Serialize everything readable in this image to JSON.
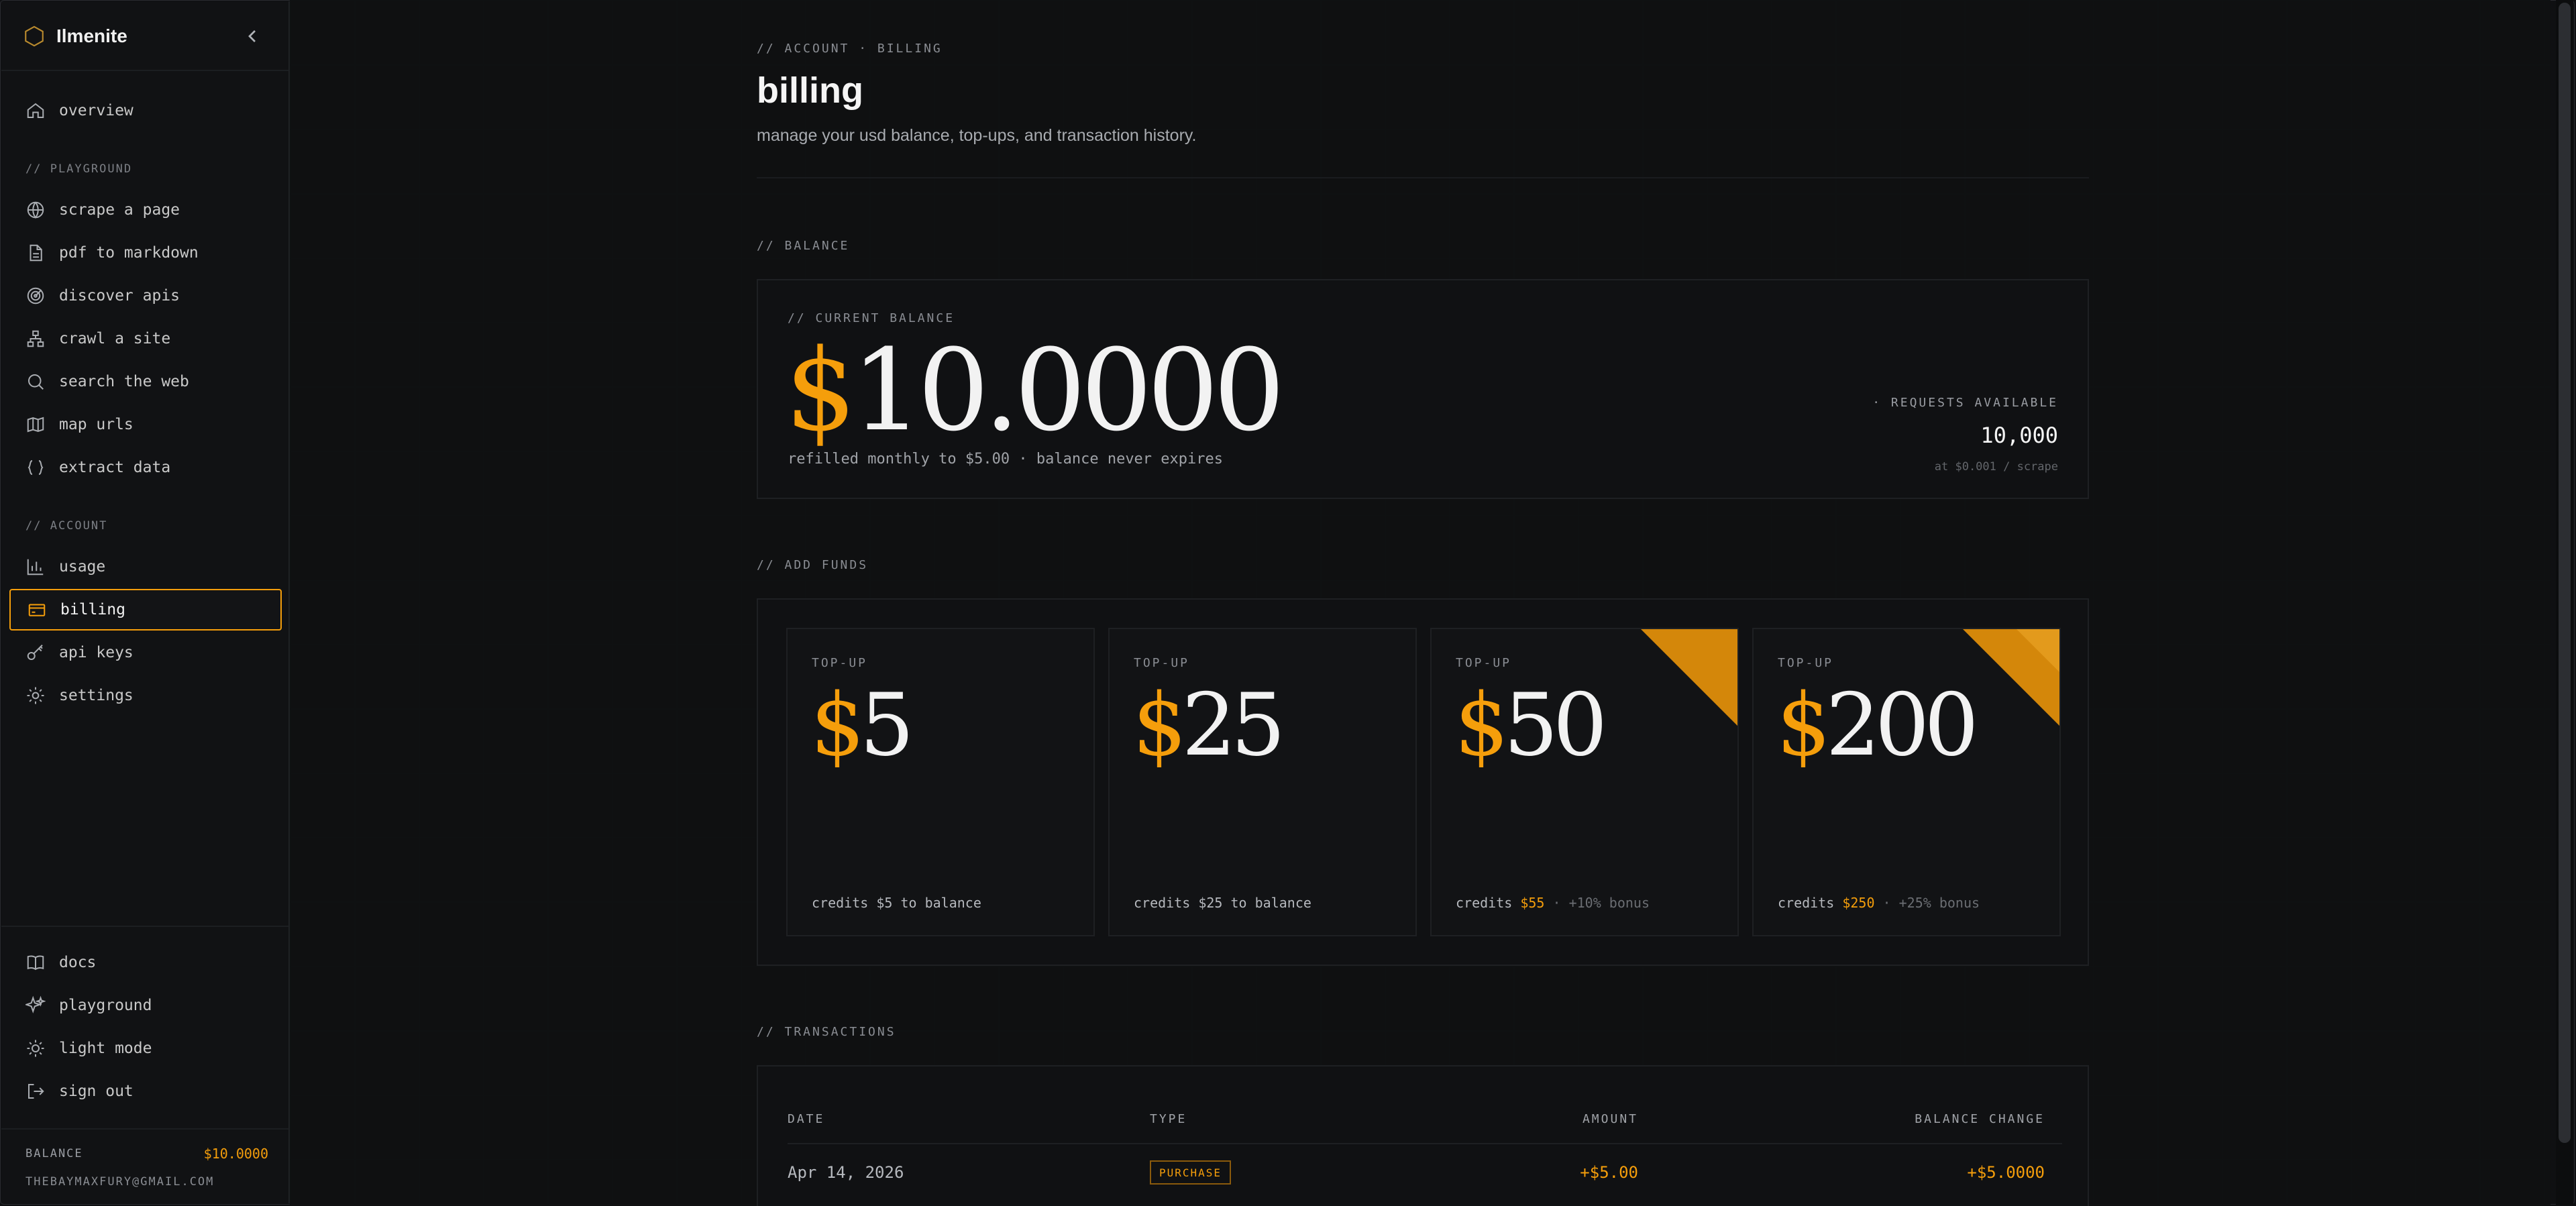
{
  "brand": {
    "name": "Ilmenite"
  },
  "sidebar": {
    "top_items": [
      {
        "label": "overview",
        "icon": "home-icon"
      }
    ],
    "playground_label": "// PLAYGROUND",
    "playground_items": [
      {
        "label": "scrape a page",
        "icon": "globe-icon"
      },
      {
        "label": "pdf to markdown",
        "icon": "file-icon"
      },
      {
        "label": "discover apis",
        "icon": "radar-icon"
      },
      {
        "label": "crawl a site",
        "icon": "sitemap-icon"
      },
      {
        "label": "search the web",
        "icon": "search-icon"
      },
      {
        "label": "map urls",
        "icon": "map-icon"
      },
      {
        "label": "extract data",
        "icon": "braces-icon"
      }
    ],
    "account_label": "// ACCOUNT",
    "account_items": [
      {
        "label": "usage",
        "icon": "bar-chart-icon"
      },
      {
        "label": "billing",
        "icon": "credit-card-icon",
        "active": true
      },
      {
        "label": "api keys",
        "icon": "key-icon"
      },
      {
        "label": "settings",
        "icon": "gear-icon"
      }
    ],
    "bottom_items": [
      {
        "label": "docs",
        "icon": "book-icon"
      },
      {
        "label": "playground",
        "icon": "sparkles-icon"
      },
      {
        "label": "light mode",
        "icon": "sun-icon"
      },
      {
        "label": "sign out",
        "icon": "logout-icon"
      }
    ],
    "balance_label": "BALANCE",
    "balance_value": "$10.0000",
    "email": "THEBAYMAXFURY@GMAIL.COM"
  },
  "page": {
    "breadcrumb": "// ACCOUNT · BILLING",
    "title": "billing",
    "subtitle": "manage your usd balance, top-ups, and transaction history."
  },
  "balance": {
    "section_title": "// BALANCE",
    "label": "// CURRENT BALANCE",
    "currency": "$",
    "amount": "10.0000",
    "refill_note": "refilled monthly to $5.00 · balance never expires",
    "requests_label": "· REQUESTS AVAILABLE",
    "requests_value": "10,000",
    "rate_note": "at $0.001 / scrape"
  },
  "add_funds": {
    "section_title": "// ADD FUNDS",
    "cards": [
      {
        "kicker": "TOP-UP",
        "currency": "$",
        "amount": "5",
        "note_prefix": "credits $5 to balance",
        "note_highlight": "",
        "note_suffix": "",
        "ribbon": false
      },
      {
        "kicker": "TOP-UP",
        "currency": "$",
        "amount": "25",
        "note_prefix": "credits $25 to balance",
        "note_highlight": "",
        "note_suffix": "",
        "ribbon": false
      },
      {
        "kicker": "TOP-UP",
        "currency": "$",
        "amount": "50",
        "note_prefix": "credits ",
        "note_highlight": "$55",
        "note_suffix": " · +10% bonus",
        "ribbon": true
      },
      {
        "kicker": "TOP-UP",
        "currency": "$",
        "amount": "200",
        "note_prefix": "credits ",
        "note_highlight": "$250",
        "note_suffix": " · +25% bonus",
        "ribbon": true
      }
    ]
  },
  "transactions": {
    "section_title": "// TRANSACTIONS",
    "headers": {
      "date": "DATE",
      "type": "TYPE",
      "amount": "AMOUNT",
      "balance_change": "BALANCE CHANGE"
    },
    "rows": [
      {
        "date": "Apr 14, 2026",
        "type": "PURCHASE",
        "amount": "+$5.00",
        "balance_change": "+$5.0000"
      }
    ]
  },
  "colors": {
    "accent": "#f59e0b",
    "background": "#0f1012",
    "panel_border": "#1e2023"
  }
}
